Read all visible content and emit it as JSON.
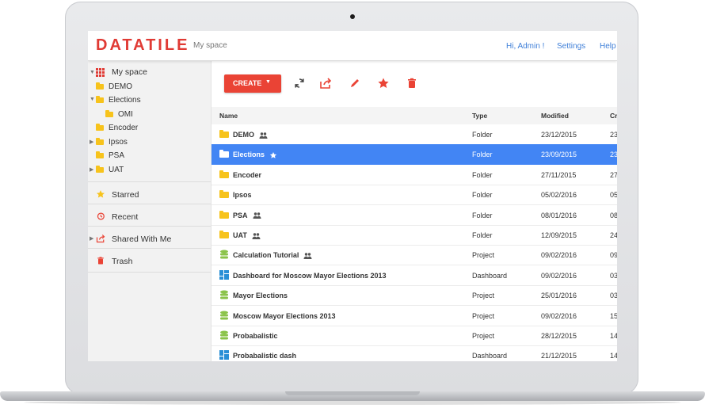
{
  "header": {
    "logo": "DATATILE",
    "section": "My space",
    "greeting": "Hi, Admin !",
    "settings": "Settings",
    "help": "Help"
  },
  "sidebar": {
    "root": "My space",
    "tree": [
      {
        "label": "DEMO",
        "expander": ""
      },
      {
        "label": "Elections",
        "expander": "open"
      },
      {
        "label": "OMI",
        "expander": ""
      },
      {
        "label": "Encoder",
        "expander": ""
      },
      {
        "label": "Ipsos",
        "expander": "closed"
      },
      {
        "label": "PSA",
        "expander": ""
      },
      {
        "label": "UAT",
        "expander": "closed"
      }
    ],
    "sections": [
      {
        "label": "Starred",
        "icon": "star-icon"
      },
      {
        "label": "Recent",
        "icon": "history-icon"
      },
      {
        "label": "Shared With Me",
        "icon": "share-icon"
      },
      {
        "label": "Trash",
        "icon": "trash-icon"
      }
    ]
  },
  "toolbar": {
    "create": "CREATE",
    "icons": [
      "refresh-icon",
      "share-icon",
      "edit-icon",
      "star-icon",
      "delete-icon"
    ]
  },
  "table": {
    "columns": [
      "Name",
      "Type",
      "Modified",
      "Cr"
    ],
    "rows": [
      {
        "name": "DEMO",
        "type": "Folder",
        "modified": "23/12/2015",
        "created": "23",
        "icon": "folder",
        "shared": true,
        "starred": false
      },
      {
        "name": "Elections",
        "type": "Folder",
        "modified": "23/09/2015",
        "created": "23",
        "icon": "folder",
        "shared": false,
        "starred": true,
        "selected": true
      },
      {
        "name": "Encoder",
        "type": "Folder",
        "modified": "27/11/2015",
        "created": "27",
        "icon": "folder",
        "shared": false,
        "starred": false
      },
      {
        "name": "Ipsos",
        "type": "Folder",
        "modified": "05/02/2016",
        "created": "05",
        "icon": "folder",
        "shared": false,
        "starred": false
      },
      {
        "name": "PSA",
        "type": "Folder",
        "modified": "08/01/2016",
        "created": "08",
        "icon": "folder",
        "shared": true,
        "starred": false
      },
      {
        "name": "UAT",
        "type": "Folder",
        "modified": "12/09/2015",
        "created": "24",
        "icon": "folder",
        "shared": true,
        "starred": false
      },
      {
        "name": "Calculation Tutorial",
        "type": "Project",
        "modified": "09/02/2016",
        "created": "09",
        "icon": "project",
        "shared": true,
        "starred": false
      },
      {
        "name": "Dashboard for Moscow Mayor Elections 2013",
        "type": "Dashboard",
        "modified": "09/02/2016",
        "created": "03",
        "icon": "dashboard",
        "shared": false,
        "starred": false
      },
      {
        "name": "Mayor Elections",
        "type": "Project",
        "modified": "25/01/2016",
        "created": "03",
        "icon": "project",
        "shared": false,
        "starred": false
      },
      {
        "name": "Moscow Mayor Elections 2013",
        "type": "Project",
        "modified": "09/02/2016",
        "created": "15",
        "icon": "project",
        "shared": false,
        "starred": false
      },
      {
        "name": "Probabalistic",
        "type": "Project",
        "modified": "28/12/2015",
        "created": "14",
        "icon": "project",
        "shared": false,
        "starred": false
      },
      {
        "name": "Probabalistic dash",
        "type": "Dashboard",
        "modified": "21/12/2015",
        "created": "14",
        "icon": "dashboard",
        "shared": false,
        "starred": false
      }
    ]
  },
  "colors": {
    "brand": "#e03a34",
    "accent": "#ea4335",
    "selection": "#4285f4",
    "link": "#3f7fd8",
    "folder": "#f7c31c",
    "project": "#8bc34a",
    "dashboard": "#2a8fd6"
  }
}
